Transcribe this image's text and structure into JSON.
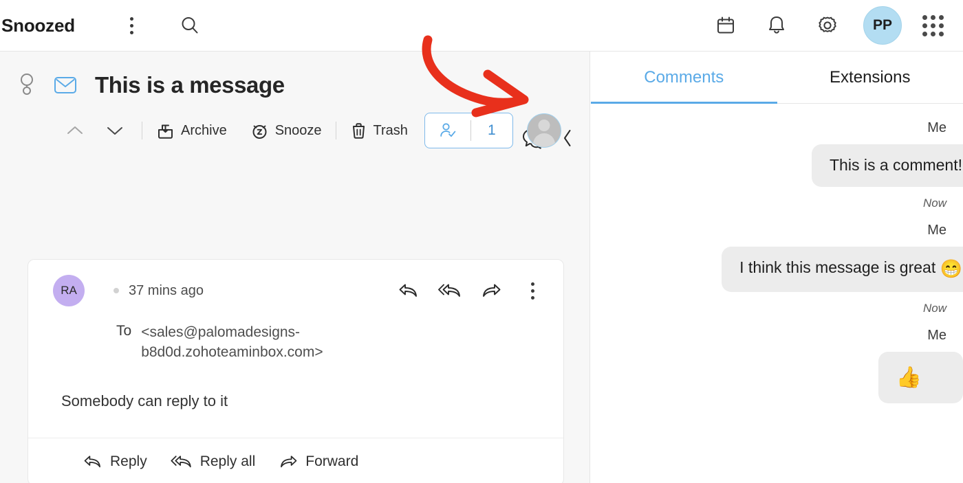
{
  "topbar": {
    "folder_title": "Snoozed",
    "kebab_label": "more-options",
    "search_label": "search",
    "icons": [
      "calendar-icon",
      "bell-icon",
      "gear-icon",
      "grid-icon"
    ],
    "avatar_initials": "PP"
  },
  "message": {
    "subject": "This is a message",
    "balloon_icon": "balloon-icon",
    "mail_icon": "mail-icon",
    "chat_icon": "chat-bubbles-icon",
    "collapse_icon": "chevron-left-icon",
    "toolbar": {
      "prev_label": "previous",
      "next_label": "next",
      "archive_label": "Archive",
      "snooze_label": "Snooze",
      "trash_label": "Trash",
      "assign_count": "1"
    },
    "card": {
      "sender_initials": "RA",
      "time": "37 mins ago",
      "to_label": "To",
      "to_value": "<sales@palomadesigns-b8d0d.zohoteaminbox.com>",
      "body": "Somebody can reply to it",
      "head_actions": [
        "reply-icon",
        "reply-all-icon",
        "forward-icon",
        "more-options-icon"
      ],
      "footer": {
        "reply_label": "Reply",
        "reply_all_label": "Reply all",
        "forward_label": "Forward"
      }
    }
  },
  "right_panel": {
    "tabs": [
      {
        "label": "Comments",
        "active": true
      },
      {
        "label": "Extensions",
        "active": false
      }
    ],
    "comments": [
      {
        "author": "Me",
        "text": "This is a comment!",
        "time": "Now",
        "emoji": ""
      },
      {
        "author": "Me",
        "text": "I think this message is great ",
        "time": "Now",
        "emoji": "😁"
      },
      {
        "author": "Me",
        "text": "",
        "time": "",
        "emoji": "👍"
      }
    ]
  },
  "annotation": {
    "type": "red-curved-arrow",
    "color": "#e8301c",
    "points_to": "chat-bubbles-icon"
  },
  "colors": {
    "accent_blue": "#5aaae7",
    "avatar_blue": "#b3ddf2",
    "avatar_purple": "#c3aef0",
    "bubble_grey": "#ececec",
    "pane_grey": "#f7f7f7",
    "annotation_red": "#e8301c"
  }
}
